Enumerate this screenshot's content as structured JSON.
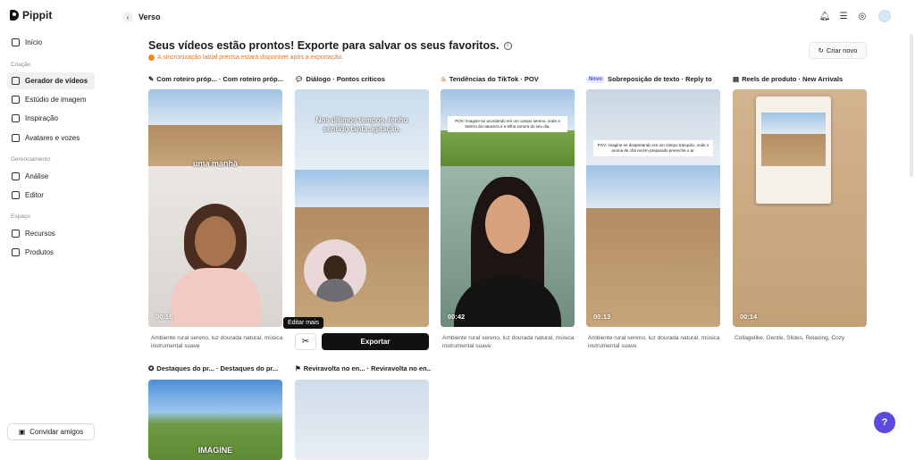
{
  "app": {
    "name": "Pippit",
    "page_title": "Verso"
  },
  "sidebar": {
    "items_top": [
      {
        "label": "Início",
        "icon": "home-icon"
      }
    ],
    "sections": [
      {
        "title": "Criação",
        "items": [
          {
            "label": "Gerador de vídeos",
            "active": true
          },
          {
            "label": "Estúdio de imagem"
          },
          {
            "label": "Inspiração"
          },
          {
            "label": "Avatares e vozes"
          }
        ]
      },
      {
        "title": "Gerenciamento",
        "items": [
          {
            "label": "Análise"
          },
          {
            "label": "Editor"
          }
        ]
      },
      {
        "title": "Espaço",
        "items": [
          {
            "label": "Recursos"
          },
          {
            "label": "Produtos"
          }
        ]
      }
    ],
    "invite_label": "Convidar amigos"
  },
  "header": {
    "headline": "Seus vídeos estão prontos! Exporte para salvar os seus favoritos.",
    "warning": "A sincronização labial precisa estará disponível após a exportação.",
    "create_new": "Criar novo"
  },
  "cards": [
    {
      "title": "Com roteiro próp... · Com roteiro próp...",
      "duration": "00:16",
      "overlay": "uma manhã",
      "caption": "Ambiente rural sereno, luz dourada natural, música instrumental suave"
    },
    {
      "title": "Diálogo · Pontos críticos",
      "overlay": "Nos últimos tempos, tenho sentido tanta agitação.",
      "tooltip": "Editar mais",
      "export": "Exportar"
    },
    {
      "title": "Tendências do TikTok · POV",
      "duration": "00:42",
      "overlay": "POV: imagine-se acordando em um campo sereno, onde a beleza da natureza é a trilha sonora do seu dia.",
      "caption": "Ambiente rural sereno, luz dourada natural, música instrumental suave"
    },
    {
      "badge": "Novo",
      "title": "Sobreposição de texto · Reply to",
      "duration": "00:13",
      "overlay": "POV: imagine-se despertando em um campo tranquilo, onde o aroma de chá recém-preparado preenche o ar.",
      "caption": "Ambiente rural sereno, luz dourada natural, música instrumental suave"
    },
    {
      "title": "Reels de produto · New Arrivals",
      "duration": "00:14",
      "caption": "Collagelike, Gentle, Slides, Relaxing, Cozy"
    },
    {
      "title": "Destaques do pr... · Destaques do pr...",
      "overlay": "IMAGINE"
    },
    {
      "title": "Reviravolta no en... · Reviravolta no en..."
    }
  ]
}
